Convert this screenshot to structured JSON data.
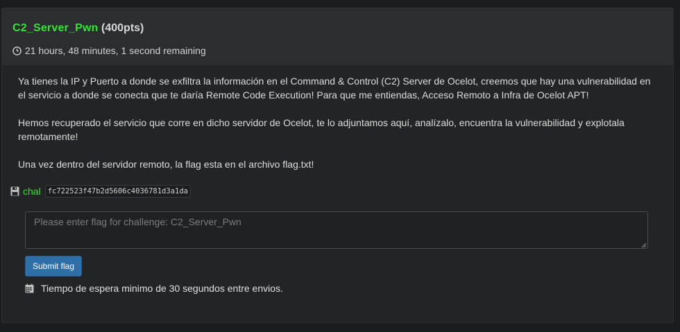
{
  "challenge": {
    "name": "C2_Server_Pwn",
    "points": "(400pts)",
    "time_remaining": "21 hours, 48 minutes, 1 second remaining"
  },
  "description": [
    "Ya tienes la IP y Puerto a donde se exfiltra la información en el Command & Control (C2) Server de Ocelot, creemos que hay una vulnerabilidad en el servicio a donde se conecta que te daría Remote Code Execution! Para que me entiendas, Acceso Remoto a Infra de Ocelot APT!",
    "Hemos recuperado el servicio que corre en dicho servidor de Ocelot, te lo adjuntamos aquí, analízalo, encuentra la vulnerabilidad y explotala remotamente!",
    "Una vez dentro del servidor remoto, la flag esta en el archivo flag.txt!"
  ],
  "file": {
    "icon": "floppy-disk-icon",
    "name": "chal",
    "hash": "fc722523f47b2d5606c4036781d3a1da"
  },
  "flag_input": {
    "value": "",
    "placeholder": "Please enter flag for challenge: C2_Server_Pwn"
  },
  "submit": {
    "label": "Submit flag"
  },
  "wait_notice": {
    "icon": "calendar-icon",
    "text": "Tiempo de espera minimo de 30 segundos entre envios."
  },
  "colors": {
    "accent_green": "#2ee82e",
    "button_blue": "#2f6fa7",
    "background": "#1a1c1e",
    "panel": "#222426",
    "panel_header": "#2b2d30"
  }
}
